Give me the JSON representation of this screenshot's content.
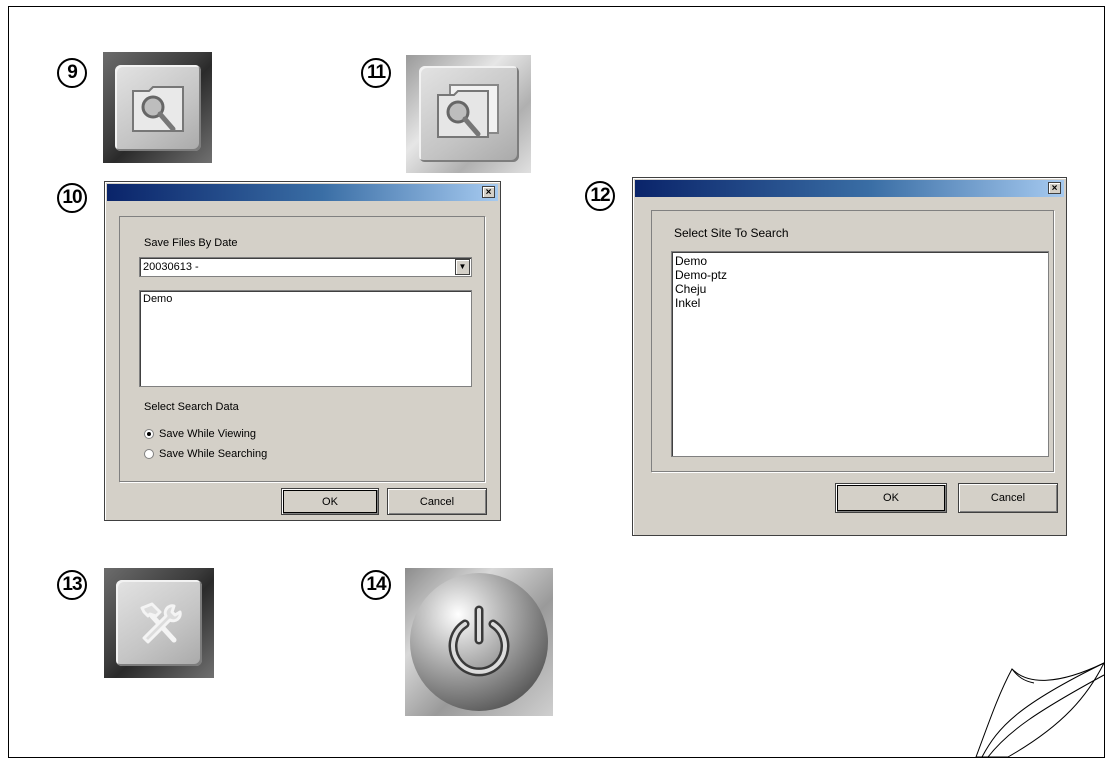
{
  "callouts": {
    "c9": "9",
    "c10": "10",
    "c11": "11",
    "c12": "12",
    "c13": "13",
    "c14": "14"
  },
  "icons": {
    "search_single": "folder-search-icon",
    "search_multi": "multi-folder-search-icon",
    "tools": "hammer-wrench-icon",
    "power": "power-icon"
  },
  "dialog_save_by_date": {
    "close_glyph": "×",
    "group_label": "Save Files By Date",
    "date_value": "20030613 -",
    "sites": [
      "Demo"
    ],
    "search_data_label": "Select Search Data",
    "options": [
      "Save While Viewing",
      "Save While Searching"
    ],
    "selected_option": 0,
    "ok_label": "OK",
    "cancel_label": "Cancel"
  },
  "dialog_select_site": {
    "close_glyph": "×",
    "group_label": "Select Site To Search",
    "sites": [
      "Demo",
      "Demo-ptz",
      "Cheju",
      "Inkel"
    ],
    "ok_label": "OK",
    "cancel_label": "Cancel"
  },
  "colors": {
    "titlebar_start": "#0a246a",
    "titlebar_end": "#a6caf0",
    "dialog_face": "#d4d0c8"
  }
}
